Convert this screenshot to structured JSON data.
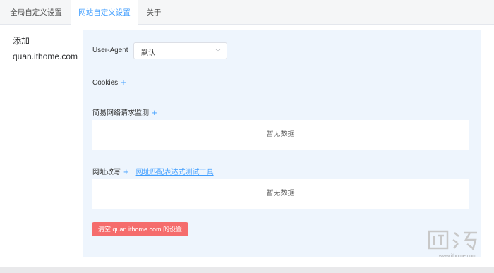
{
  "tabs": {
    "global": "全局自定义设置",
    "site": "网站自定义设置",
    "about": "关于"
  },
  "sidebar": {
    "add": "添加",
    "site": "quan.ithome.com"
  },
  "form": {
    "ua_label": "User-Agent",
    "ua_value": "默认",
    "cookies_label": "Cookies",
    "netmon_label": "简易网络请求监测",
    "netmon_empty": "暂无数据",
    "rewrite_label": "网址改写",
    "rewrite_link": "网址匹配表达式测试工具",
    "rewrite_empty": "暂无数据",
    "plus": "+",
    "clear_button": "清空 quan.ithome.com 的设置"
  },
  "watermark": {
    "text": "www.ithome.com"
  },
  "colors": {
    "accent": "#409eff",
    "danger": "#f56c6c",
    "panel": "#eef5fd"
  }
}
